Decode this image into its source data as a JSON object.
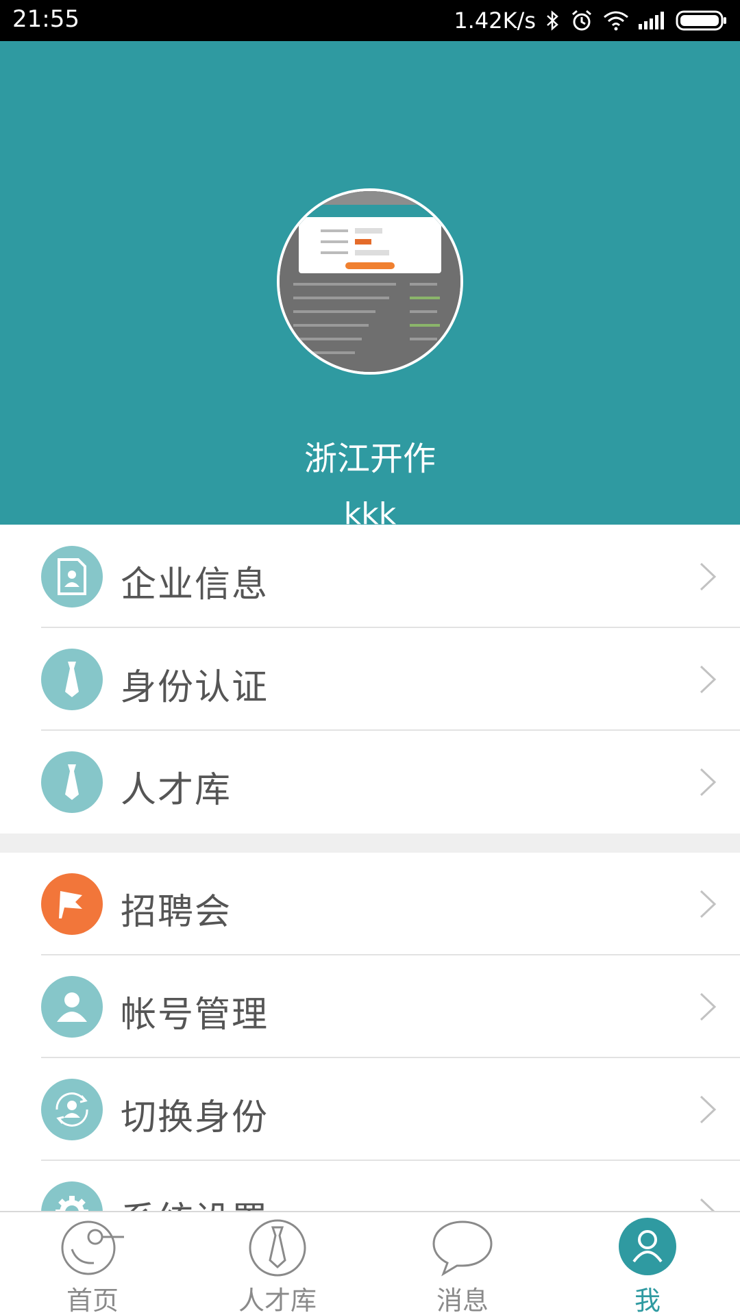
{
  "status_bar": {
    "time": "21:55",
    "net_speed": "1.42K/s",
    "icons": [
      "bluetooth-icon",
      "alarm-icon",
      "wifi-icon",
      "signal-icon",
      "battery-icon"
    ]
  },
  "profile": {
    "company": "浙江开作",
    "username": "kkk"
  },
  "menu_group_1": [
    {
      "label": "企业信息",
      "icon": "contact-card-icon",
      "color": "#86c6c9"
    },
    {
      "label": "身份认证",
      "icon": "tie-icon",
      "color": "#86c6c9"
    },
    {
      "label": "人才库",
      "icon": "tie-icon",
      "color": "#86c6c9"
    }
  ],
  "menu_group_2": [
    {
      "label": "招聘会",
      "icon": "flag-icon",
      "color": "#f2763a"
    },
    {
      "label": "帐号管理",
      "icon": "user-icon",
      "color": "#86c6c9"
    },
    {
      "label": "切换身份",
      "icon": "switch-user-icon",
      "color": "#86c6c9"
    },
    {
      "label": "系统设置",
      "icon": "gear-icon",
      "color": "#86c6c9"
    }
  ],
  "bottom_nav": [
    {
      "label": "首页",
      "icon": "home-icon",
      "active": false
    },
    {
      "label": "人才库",
      "icon": "tie-icon",
      "active": false
    },
    {
      "label": "消息",
      "icon": "chat-bubble-icon",
      "active": false
    },
    {
      "label": "我",
      "icon": "user-icon",
      "active": true
    }
  ],
  "colors": {
    "header_bg": "#2f9aa1",
    "accent": "#2f9aa1",
    "icon_teal": "#86c6c9",
    "icon_orange": "#f2763a"
  }
}
